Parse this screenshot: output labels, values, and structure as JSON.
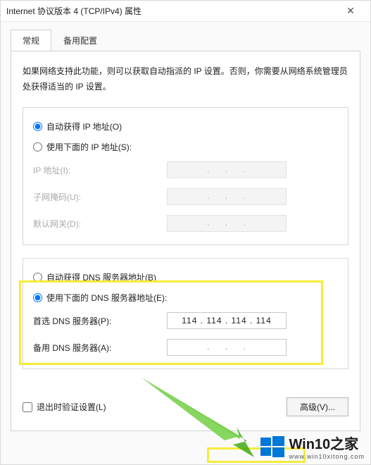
{
  "window": {
    "title": "Internet 协议版本 4 (TCP/IPv4) 属性",
    "close": "✕"
  },
  "tabs": {
    "general": "常规",
    "alternate": "备用配置"
  },
  "intro": "如果网络支持此功能，则可以获取自动指派的 IP 设置。否则，你需要从网络系统管理员处获得适当的 IP 设置。",
  "ip_group": {
    "auto": "自动获得 IP 地址(O)",
    "manual": "使用下面的 IP 地址(S):",
    "ip_label": "IP 地址(I):",
    "mask_label": "子网掩码(U):",
    "gateway_label": "默认网关(D):"
  },
  "dns_group": {
    "auto": "自动获得 DNS 服务器地址(B)",
    "manual": "使用下面的 DNS 服务器地址(E):",
    "preferred_label": "首选 DNS 服务器(P):",
    "alternate_label": "备用 DNS 服务器(A):",
    "preferred_value": "114 . 114 . 114 . 114"
  },
  "footer": {
    "validate": "退出时验证设置(L)",
    "advanced": "高级(V)..."
  },
  "watermark": {
    "main": "Win10之家",
    "sub": "www.win10xitong.com"
  }
}
